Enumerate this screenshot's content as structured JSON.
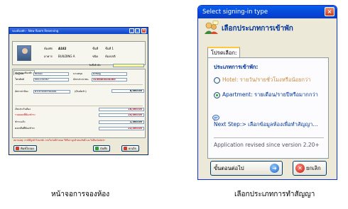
{
  "left_window": {
    "title": "จองห้องพัก - New Room Reserving",
    "tab_general": "General",
    "room_no_label": "ห้องพัก",
    "room_no_value": "A182",
    "floor_label": "ชั้นที่",
    "floor_value": "ชั้นที่ 1",
    "building_label": "อาคาร",
    "building_value": "BUILDING A",
    "type_label": "ชนิด",
    "type_value": "ห้องปกติ",
    "tab_reservation": "การจองห้องพัก",
    "tab_customer": "ข้อมูลลูกค้า",
    "checkin_label": "วันที่เข้าพัก",
    "firstname_label": "ชื่อผู้จอง",
    "firstname_value": "ทดลอง",
    "lastname_label": "นามสกุล",
    "lastname_value": "ตั้งชื่อดู",
    "phone_label": "โทรศัพท์",
    "phone_value": "081234567",
    "idcard_label": "บัตรประชาชน",
    "idcard_value": "3156465454565",
    "rent_label": "อัตราค่าห้อง",
    "rent_type": "ค่าเช่าปกติรายเดือน",
    "deposit_label": "(เงินมัดจำ)",
    "rent_value": "8,000.00",
    "prepay_label": "เงินประกันห้อง",
    "prepay_value": "16,000.00",
    "total_label": "รวมยอดที่ต้องชำระ",
    "total_value": "24,000.00",
    "paid_label": "ชำระแล้ว",
    "paid_value": "1,500.00",
    "remain_label": "คงเหลือที่ต้องชำระ",
    "remain_value": "22,500.00",
    "warning_text": "หมายเหตุ: กรณีที่ลูกค้าไม่มาพัก ภายในวันที่กำหนด ให้ถือว่าลูกค้าสละสิทธิ์ และไม่คืนเงินมัดจำ",
    "btn_print": "พิมพ์ใบจอง",
    "btn_save": "บันทึก",
    "btn_cancel": "ยกเลิก"
  },
  "right_window": {
    "title": "Select signing-in type",
    "close_label": "×",
    "header_title": "เลือกประเภทการเข้าพัก",
    "tab_label": "โปรดเลือก:",
    "section_label": "ประเภทการเข้าพัก:",
    "option_hotel": "Hotel: รายวัน/รายชั่วโมงหรือน้อยกว่า",
    "option_apartment": "Apartment: รายเดือน/รายปีหรือมากกว่า",
    "next_step": "Next Step:> เลือกข้อมูลห้องเพื่อทำสัญญา...",
    "revised_note": "Application revised since version 2.20+",
    "btn_next": "ขั้นตอนต่อไป",
    "btn_cancel": "ยกเลิก",
    "selected_option": "apartment"
  },
  "captions": {
    "left": "หน้าจอการจองห้อง",
    "right": "เลือกประเภทการทำสัญญา"
  },
  "colors": {
    "titlebar": "#0a5fec",
    "accent_blue": "#003399",
    "warning_red": "#cc0000",
    "dim_option": "#c88a3c"
  }
}
